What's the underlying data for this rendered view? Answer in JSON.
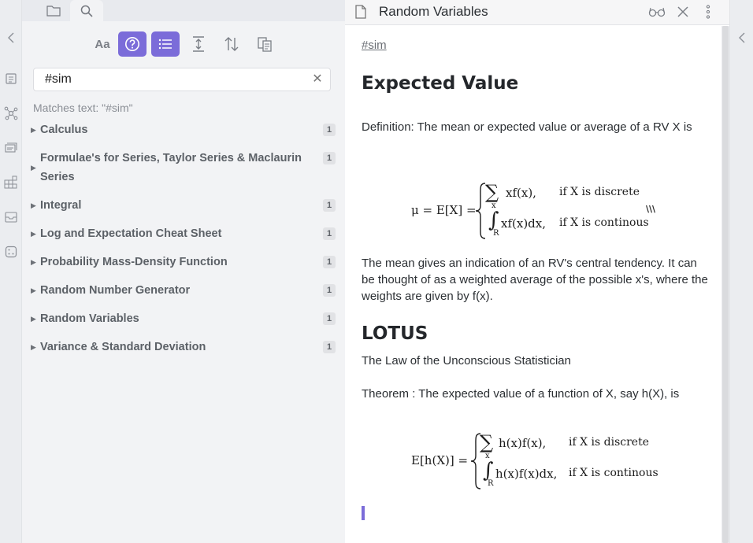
{
  "search": {
    "query": "#sim",
    "matches_label": "Matches text: \"#sim\"",
    "clear_icon": "close-icon",
    "toolbar": [
      "match-case-icon",
      "explain-search-icon",
      "collapse-results-icon",
      "context-icon",
      "sort-icon",
      "copy-results-icon"
    ],
    "results": [
      {
        "label": "Calculus",
        "count": "1"
      },
      {
        "label": "Formulae's for Series, Taylor Series & Maclaurin Series",
        "count": "1"
      },
      {
        "label": "Integral",
        "count": "1"
      },
      {
        "label": "Log and Expectation Cheat Sheet",
        "count": "1"
      },
      {
        "label": "Probability Mass-Density Function",
        "count": "1"
      },
      {
        "label": "Random Number Generator",
        "count": "1"
      },
      {
        "label": "Random Variables",
        "count": "1"
      },
      {
        "label": "Variance & Standard Deviation",
        "count": "1"
      }
    ]
  },
  "editor": {
    "title": "Random Variables",
    "tag": "#sim",
    "h1_expected": "Expected Value",
    "definition": "Definition: The mean or expected value or average of a RV X is",
    "eq1": {
      "lhs": "μ = E[X] =",
      "row1_expr": "xf(x),",
      "row1_sub": "x",
      "row1_cond": "if X is discrete",
      "row2_expr": "xf(x)dx,",
      "row2_sub": "R",
      "row2_cond": "if X is continous",
      "scribble": "\\\\\\"
    },
    "mean_paragraph": "The mean gives an indication of an RV's central tendency. It can be thought of as a weighted average of the possible x's, where the weights are given by f(x).",
    "h1_lotus": "LOTUS",
    "lotus_subtitle": "The Law of the Unconscious Statistician",
    "theorem": "Theorem : The expected value of a function of X, say h(X), is",
    "eq2": {
      "lhs": "E[h(X)] =",
      "row1_expr": "h(x)f(x),",
      "row1_sub": "x",
      "row1_cond": "if X is discrete",
      "row2_expr": "h(x)f(x)dx,",
      "row2_sub": "R",
      "row2_cond": "if X is continous"
    }
  },
  "colors": {
    "accent": "#7b6cd9",
    "sidebar_bg": "#f2f3f5",
    "ribbon_bg": "#ebedf0"
  }
}
